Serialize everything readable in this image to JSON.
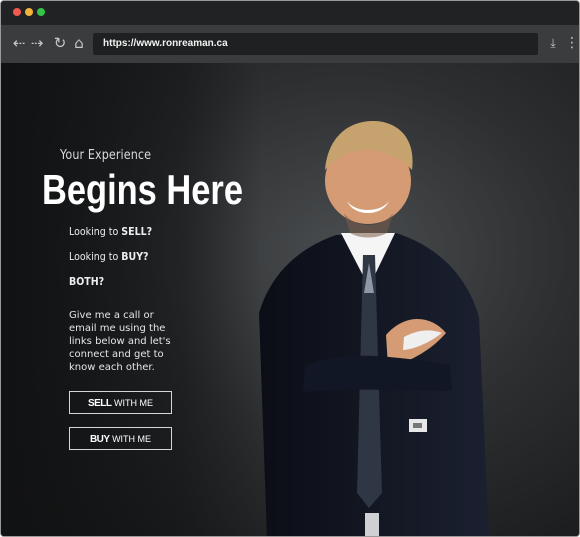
{
  "browser": {
    "url": "https://www.ronreaman.ca",
    "window_dots": [
      "close",
      "minimize",
      "maximize"
    ],
    "icons": {
      "back": "back-arrow-icon",
      "forward": "forward-arrow-icon",
      "reload": "reload-icon",
      "home": "home-icon",
      "download": "download-icon",
      "menu": "menu-icon"
    }
  },
  "hero": {
    "subtitle": "Your Experience",
    "title": "Begins Here",
    "questions": [
      {
        "prefix": "Looking to ",
        "highlight": "SELL?"
      },
      {
        "prefix": "Looking to ",
        "highlight": "BUY?"
      },
      {
        "prefix": "",
        "highlight": "BOTH?"
      }
    ],
    "description": "Give me a call or email me using the links below and let's connect and get to know each other.",
    "buttons": [
      {
        "strong": "SELL",
        "rest": " WITH ME"
      },
      {
        "strong": "BUY",
        "rest": " WITH ME"
      }
    ]
  },
  "colors": {
    "browser_bar": "#3b3c3e",
    "address_bar": "#1f2021",
    "hero_dark": "#141617",
    "button_border": "#d6d6d6"
  }
}
